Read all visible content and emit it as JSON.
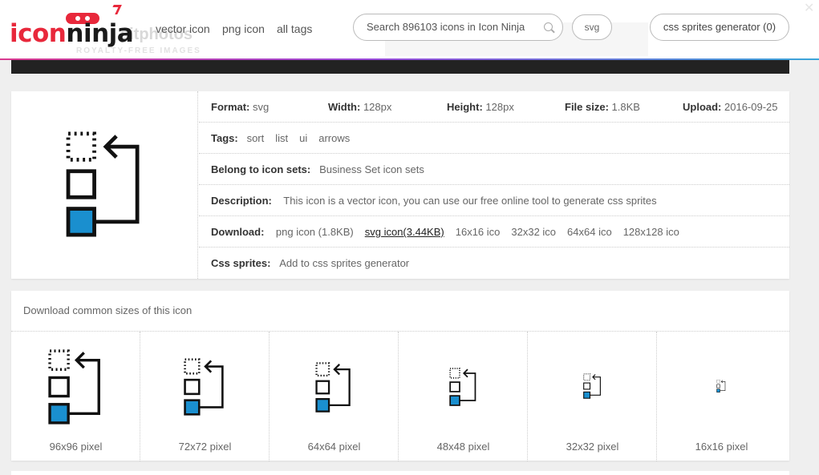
{
  "header": {
    "logo": {
      "part1": "icon",
      "part2": "ninja"
    },
    "background_ad": {
      "text": "sitphotos",
      "subtext": "ROYALTY-FREE IMAGES"
    },
    "nav": {
      "vector_icon": "vector icon",
      "png_icon": "png icon",
      "all_tags": "all tags"
    },
    "search": {
      "placeholder": "Search 896103 icons in Icon Ninja",
      "icon": "search-icon"
    },
    "svg_toggle": "svg",
    "css_sprites_button": "css sprites generator (0)"
  },
  "details": {
    "format": {
      "label": "Format:",
      "value": "svg"
    },
    "width": {
      "label": "Width:",
      "value": "128px"
    },
    "height": {
      "label": "Height:",
      "value": "128px"
    },
    "file_size": {
      "label": "File size:",
      "value": "1.8KB"
    },
    "upload": {
      "label": "Upload:",
      "value": "2016-09-25"
    },
    "tags": {
      "label": "Tags:",
      "items": [
        "sort",
        "list",
        "ui",
        "arrows"
      ]
    },
    "icon_sets": {
      "label": "Belong to icon sets:",
      "value": "Business Set icon sets"
    },
    "description": {
      "label": "Description:",
      "value": "This icon is a vector icon, you can use our free online tool to generate css sprites"
    },
    "download": {
      "label": "Download:",
      "links": [
        "png icon (1.8KB)",
        "svg icon(3.44KB)",
        "16x16 ico",
        "32x32 ico",
        "64x64 ico",
        "128x128 ico"
      ]
    },
    "css_sprites": {
      "label": "Css sprites:",
      "value": "Add to css sprites generator"
    }
  },
  "sizes": {
    "title": "Download common sizes of this icon",
    "items": [
      {
        "label": "96x96 pixel",
        "size": 96
      },
      {
        "label": "72x72 pixel",
        "size": 72
      },
      {
        "label": "64x64 pixel",
        "size": 64
      },
      {
        "label": "48x48 pixel",
        "size": 48
      },
      {
        "label": "32x32 pixel",
        "size": 32
      },
      {
        "label": "16x16 pixel",
        "size": 16
      }
    ]
  },
  "colors": {
    "accent_blue": "#1a8fcf",
    "logo_red": "#e8283b"
  }
}
